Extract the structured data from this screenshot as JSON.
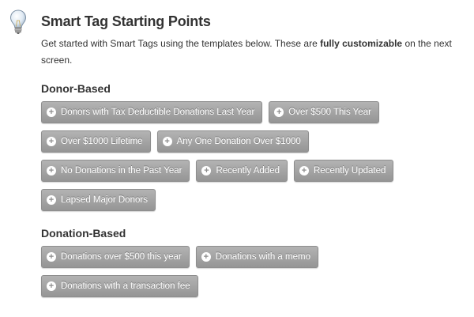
{
  "header": {
    "title": "Smart Tag Starting Points",
    "intro_before": "Get started with Smart Tags using the templates below. These are ",
    "intro_bold": "fully customizable",
    "intro_after": " on the next screen."
  },
  "icons": {
    "header_icon": "lightbulb-icon",
    "button_icon": "plus-circle-icon"
  },
  "donor_based": {
    "heading": "Donor-Based",
    "rows": [
      [
        "Donors with Tax Deductible Donations Last Year",
        "Over $500 This Year"
      ],
      [
        "Over $1000 Lifetime",
        "Any One Donation Over $1000"
      ],
      [
        "No Donations in the Past Year",
        "Recently Added",
        "Recently Updated"
      ],
      [
        "Lapsed Major Donors"
      ]
    ]
  },
  "donation_based": {
    "heading": "Donation-Based",
    "rows": [
      [
        "Donations over $500 this year",
        "Donations with a memo"
      ],
      [
        "Donations with a transaction fee"
      ]
    ]
  },
  "colors": {
    "button_gradient_top": "#b3b3b3",
    "button_gradient_bottom": "#959595",
    "text": "#333333"
  }
}
